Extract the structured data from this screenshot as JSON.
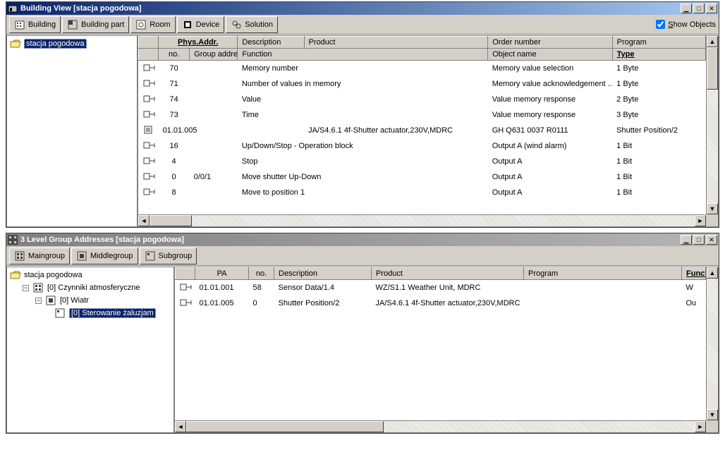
{
  "top_window": {
    "title": "Building View [stacja pogodowa]",
    "toolbar": {
      "building": "Building",
      "building_part": "Building part",
      "room": "Room",
      "device": "Device",
      "solution": "Solution",
      "show_objects_prefix": "S",
      "show_objects_rest": "how Objects"
    },
    "tree": {
      "root": "stacja pogodowa"
    },
    "grid": {
      "header1": {
        "phys_addr": "Phys.Addr.",
        "description": "Description",
        "product": "Product",
        "order_number": "Order number",
        "program": "Program"
      },
      "header2": {
        "no": "no.",
        "group_addresses": "Group addresse",
        "function": "Function",
        "object_name": "Object name",
        "type": "Type"
      },
      "rows": [
        {
          "kind": "obj",
          "no": "70",
          "ga": "",
          "func": "Memory number",
          "obj": "Memory value selection",
          "type": "1 Byte"
        },
        {
          "kind": "obj",
          "no": "71",
          "ga": "",
          "func": "Number of values in memory",
          "obj": "Memory value acknowledgement ...",
          "type": "1 Byte"
        },
        {
          "kind": "obj",
          "no": "74",
          "ga": "",
          "func": "Value",
          "obj": "Value memory response",
          "type": "2 Byte"
        },
        {
          "kind": "obj",
          "no": "73",
          "ga": "",
          "func": "Time",
          "obj": "Value memory response",
          "type": "3 Byte"
        },
        {
          "kind": "dev",
          "no": "01.01.005",
          "ga": "",
          "func": "JA/S4.6.1 4f-Shutter actuator,230V,MDRC",
          "obj": "GH Q631 0037 R0111",
          "type": "Shutter Position/2"
        },
        {
          "kind": "obj",
          "no": "16",
          "ga": "",
          "func": "Up/Down/Stop - Operation block",
          "obj": "Output A (wind alarm)",
          "type": "1 Bit"
        },
        {
          "kind": "obj",
          "no": "4",
          "ga": "",
          "func": "Stop",
          "obj": "Output A",
          "type": "1 Bit"
        },
        {
          "kind": "obj",
          "no": "0",
          "ga": "0/0/1",
          "func": "Move shutter Up-Down",
          "obj": "Output A",
          "type": "1 Bit"
        },
        {
          "kind": "obj",
          "no": "8",
          "ga": "",
          "func": "Move to position 1",
          "obj": "Output A",
          "type": "1 Bit"
        }
      ]
    }
  },
  "bottom_window": {
    "title": "3 Level Group Addresses [stacja pogodowa]",
    "toolbar": {
      "maingroup": "Maingroup",
      "middlegroup": "Middlegroup",
      "subgroup": "Subgroup"
    },
    "tree": {
      "root": "stacja pogodowa",
      "l1": "[0] Czynniki atmosferyczne",
      "l2": "[0] Wiatr",
      "l3": "[0] Sterowanie żaluzjam"
    },
    "grid": {
      "header": {
        "pa": "PA",
        "no": "no.",
        "description": "Description",
        "product": "Product",
        "program": "Program",
        "function": "Function"
      },
      "rows": [
        {
          "pa": "01.01.001",
          "no": "58",
          "desc": "Sensor Data/1.4",
          "prod": "WZ/S1.1 Weather Unit, MDRC",
          "prog": "",
          "fn": "W"
        },
        {
          "pa": "01.01.005",
          "no": "0",
          "desc": "Shutter Position/2",
          "prod": "JA/S4.6.1 4f-Shutter actuator,230V,MDRC",
          "prog": "",
          "fn": "Ou"
        }
      ]
    }
  }
}
